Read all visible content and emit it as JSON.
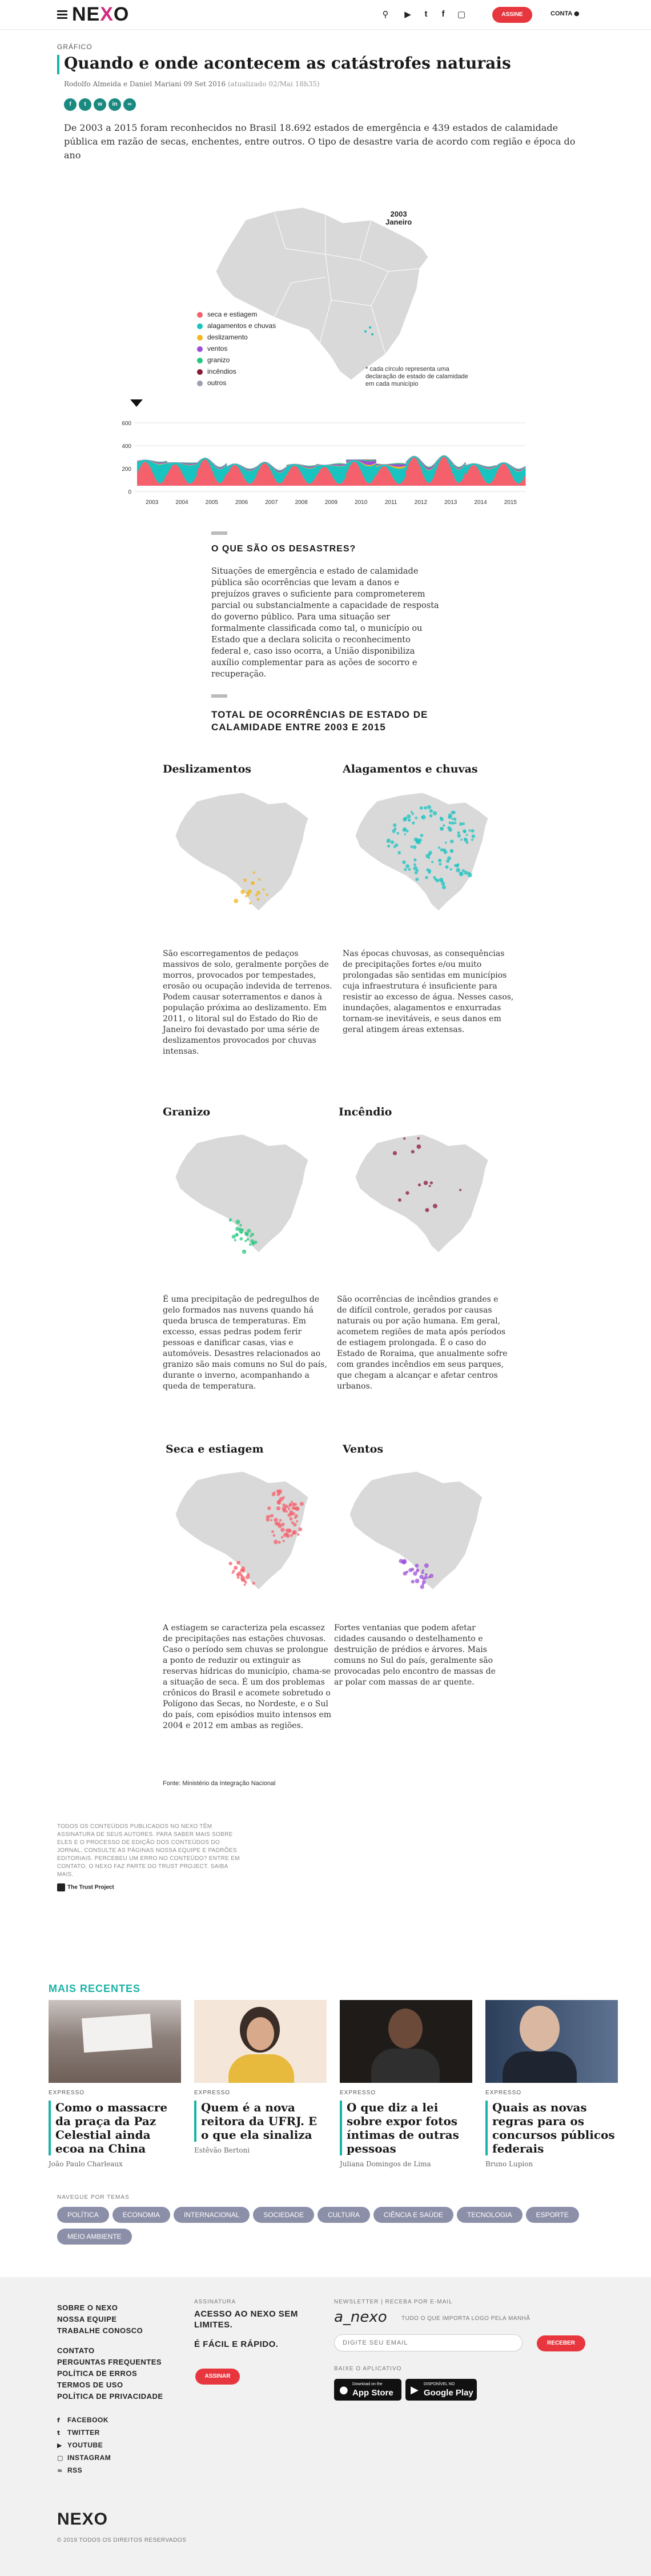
{
  "header": {
    "logo": "NEXO",
    "subscribe_label": "ASSINE",
    "account_label": "CONTA",
    "icons": [
      "menu-icon",
      "search-icon",
      "youtube-icon",
      "twitter-icon",
      "facebook-icon",
      "instagram-icon",
      "user-icon"
    ]
  },
  "article": {
    "kicker": "GRÁFICO",
    "title": "Quando e onde acontecem as catástrofes naturais",
    "byline": "Rodolfo Almeida e Daniel Mariani",
    "date": "09 Set 2016",
    "updated": "(atualizado 02/Mai 18h35)",
    "share_icons": [
      "facebook-icon",
      "twitter-icon",
      "whatsapp-icon",
      "linkedin-icon",
      "link-icon"
    ],
    "lede": "De 2003 a 2015 foram reconhecidos no Brasil 18.692 estados de emergência e 439 estados de calamidade pública em razão de secas, enchentes, entre outros. O tipo de desastre varia de acordo com região e época do ano"
  },
  "main_chart": {
    "year": "2003",
    "month": "Janeiro",
    "legend": [
      {
        "label": "seca e estiagem",
        "color": "#f4606b"
      },
      {
        "label": "alagamentos e chuvas",
        "color": "#19c3c0"
      },
      {
        "label": "deslizamento",
        "color": "#f2b61e"
      },
      {
        "label": "ventos",
        "color": "#9d4ed8"
      },
      {
        "label": "granizo",
        "color": "#26c77e"
      },
      {
        "label": "incêndios",
        "color": "#8b1a3a"
      },
      {
        "label": "outros",
        "color": "#9aa0ad"
      }
    ],
    "note": "* cada círculo representa uma declaração de estado de calamidade em cada município",
    "y_ticks": [
      "600",
      "400",
      "200",
      "0"
    ],
    "x_ticks": [
      "2003",
      "2004",
      "2005",
      "2006",
      "2007",
      "2008",
      "2009",
      "2010",
      "2011",
      "2012",
      "2013",
      "2014",
      "2015"
    ]
  },
  "chart_data": {
    "type": "area",
    "x": [
      "2003",
      "2004",
      "2005",
      "2006",
      "2007",
      "2008",
      "2009",
      "2010",
      "2011",
      "2012",
      "2013",
      "2014",
      "2015"
    ],
    "ylim": [
      0,
      600
    ],
    "series": [
      {
        "name": "seca e estiagem",
        "values": [
          380,
          340,
          420,
          330,
          360,
          320,
          300,
          380,
          310,
          450,
          460,
          330,
          350
        ]
      },
      {
        "name": "alagamentos e chuvas",
        "values": [
          300,
          290,
          220,
          200,
          170,
          240,
          280,
          270,
          240,
          200,
          210,
          230,
          190
        ]
      },
      {
        "name": "deslizamento",
        "values": [
          10,
          8,
          6,
          6,
          6,
          10,
          8,
          20,
          30,
          10,
          8,
          8,
          8
        ]
      },
      {
        "name": "ventos",
        "values": [
          20,
          20,
          18,
          18,
          20,
          20,
          22,
          60,
          40,
          30,
          20,
          18,
          20
        ]
      },
      {
        "name": "granizo",
        "values": [
          10,
          12,
          10,
          10,
          12,
          12,
          14,
          18,
          16,
          14,
          12,
          12,
          12
        ]
      },
      {
        "name": "incêndios",
        "values": [
          0,
          0,
          0,
          0,
          0,
          0,
          0,
          6,
          0,
          0,
          0,
          0,
          0
        ]
      },
      {
        "name": "outros",
        "values": [
          6,
          6,
          6,
          6,
          6,
          6,
          6,
          6,
          6,
          6,
          6,
          6,
          6
        ]
      }
    ]
  },
  "section1": {
    "heading": "O QUE SÃO OS DESASTRES?",
    "body": "Situações de emergência e estado de calamidade pública são ocorrências que levam a danos e prejuízos graves o suficiente para comprometerem parcial ou substancialmente a capacidade de resposta do governo público. Para uma situação ser formalmente classificada como tal, o município ou Estado que a declara solicita o reconhecimento federal e, caso isso ocorra, a União disponibiliza auxílio complementar para as ações de socorro e recuperação."
  },
  "section2": {
    "heading": "TOTAL DE OCORRÊNCIAS DE ESTADO DE CALAMIDADE ENTRE 2003 E 2015"
  },
  "multiples": [
    {
      "title": "Deslizamentos",
      "color": "#f2b61e",
      "text": "São escorregamentos de pedaços massivos de solo, geralmente porções de morros, provocados por tempestades, erosão ou ocupação indevida de terrenos. Podem causar soterramentos e danos à população próxima ao deslizamento. Em 2011, o litoral sul do Estado do Rio de Janeiro foi devastado por uma série de deslizamentos provocados por chuvas intensas."
    },
    {
      "title": "Alagamentos e chuvas",
      "color": "#19c3c0",
      "text": "Nas épocas chuvosas, as consequências de precipitações fortes e/ou muito prolongadas são sentidas em municípios cuja infraestrutura é insuficiente para resistir ao excesso de água. Nesses casos, inundações, alagamentos e enxurradas tornam-se inevitáveis, e seus danos em geral atingem áreas extensas."
    },
    {
      "title": "Granizo",
      "color": "#26c77e",
      "text": "É uma precipitação de pedregulhos de gelo formados nas nuvens quando há queda brusca de temperaturas. Em excesso, essas pedras podem ferir pessoas e danificar casas, vias e automóveis. Desastres relacionados ao granizo são mais comuns no Sul do país, durante o inverno, acompanhando a queda de temperatura."
    },
    {
      "title": "Incêndio",
      "color": "#8b1a3a",
      "text": "São ocorrências de incêndios grandes e de difícil controle, gerados por causas naturais ou por ação humana. Em geral, acometem regiões de mata após períodos de estiagem prolongada. É o caso do Estado de Roraima, que anualmente sofre com grandes incêndios em seus parques, que chegam a alcançar e afetar centros urbanos."
    },
    {
      "title": "Seca e estiagem",
      "color": "#f4606b",
      "text": "A estiagem se caracteriza pela escassez de precipitações nas estações chuvosas. Caso o período sem chuvas se prolongue a ponto de reduzir ou extinguir as reservas hídricas do município, chama-se a situação de seca. É um dos problemas crônicos do Brasil e acomete sobretudo o Polígono das Secas, no Nordeste, e o Sul do país, com episódios muito intensos em 2004 e 2012 em ambas as regiões."
    },
    {
      "title": "Ventos",
      "color": "#9d4ed8",
      "text": "Fortes ventanias que podem afetar cidades causando o destelhamento e destruição de prédios e árvores. Mais comuns no Sul do país, geralmente são provocadas pelo encontro de massas de ar polar com massas de ar quente."
    }
  ],
  "source": "Fonte: Ministério da Integração Nacional",
  "disclaimer": "TODOS OS CONTEÚDOS PUBLICADOS NO NEXO TÊM ASSINATURA DE SEUS AUTORES. PARA SABER MAIS SOBRE ELES E O PROCESSO DE EDIÇÃO DOS CONTEÚDOS DO JORNAL, CONSULTE AS PÁGINAS NOSSA EQUIPE E PADRÕES EDITORIAIS. PERCEBEU UM ERRO NO CONTEÚDO? ENTRE EM CONTATO. O NEXO FAZ PARTE DO TRUST PROJECT. SAIBA MAIS.",
  "trust_label": "The Trust Project",
  "recent": {
    "heading": "MAIS RECENTES",
    "cards": [
      {
        "kicker": "EXPRESSO",
        "title": "Como o massacre da praça da Paz Celestial ainda ecoa na China",
        "author": "João Paulo Charleaux",
        "img_color": "#9a8f88",
        "img_icon": "protest-photo"
      },
      {
        "kicker": "EXPRESSO",
        "title": "Quem é a nova reitora da UFRJ. E o que ela sinaliza",
        "author": "Estêvão Bertoni",
        "img_color": "#e9d2b8",
        "img_icon": "portrait-photo"
      },
      {
        "kicker": "EXPRESSO",
        "title": "O que diz a lei sobre expor fotos íntimas de outras pessoas",
        "author": "Juliana Domingos de Lima",
        "img_color": "#2d2926",
        "img_icon": "portrait-photo"
      },
      {
        "kicker": "EXPRESSO",
        "title": "Quais as novas regras para os concursos públicos federais",
        "author": "Bruno Lupion",
        "img_color": "#3b4d66",
        "img_icon": "portrait-photo"
      }
    ]
  },
  "topics": {
    "heading": "NAVEGUE POR TEMAS",
    "items": [
      "POLÍTICA",
      "ECONOMIA",
      "INTERNACIONAL",
      "SOCIEDADE",
      "CULTURA",
      "CIÊNCIA E SAÚDE",
      "TECNOLOGIA",
      "ESPORTE",
      "MEIO AMBIENTE"
    ]
  },
  "footer": {
    "links1": [
      "SOBRE O NEXO",
      "NOSSA EQUIPE",
      "TRABALHE CONOSCO"
    ],
    "links2": [
      "CONTATO",
      "PERGUNTAS FREQUENTES",
      "POLÍTICA DE ERROS",
      "TERMOS DE USO",
      "POLÍTICA DE PRIVACIDADE"
    ],
    "social": [
      "FACEBOOK",
      "TWITTER",
      "YOUTUBE",
      "INSTAGRAM",
      "RSS"
    ],
    "assinatura_h": "ASSINATURA",
    "assinatura_text": "ACESSO AO NEXO SEM LIMITES.",
    "assinatura_text2": "É FÁCIL E RÁPIDO.",
    "assinar_label": "ASSINAR",
    "newsletter_h": "NEWSLETTER | RECEBA POR E-MAIL",
    "newsletter_logo": "a_nexo",
    "newsletter_desc": "TUDO O QUE IMPORTA LOGO PELA MANHÃ",
    "email_placeholder": "DIGITE SEU EMAIL",
    "receber_label": "RECEBER",
    "app_h": "BAIXE O APLICATIVO",
    "appstore_small": "Download on the",
    "appstore_big": "App Store",
    "gplay_small": "DISPONÍVEL NO",
    "gplay_big": "Google Play",
    "logo": "NEXO",
    "copyright": "© 2019 TODOS OS DIREITOS RESERVADOS"
  }
}
